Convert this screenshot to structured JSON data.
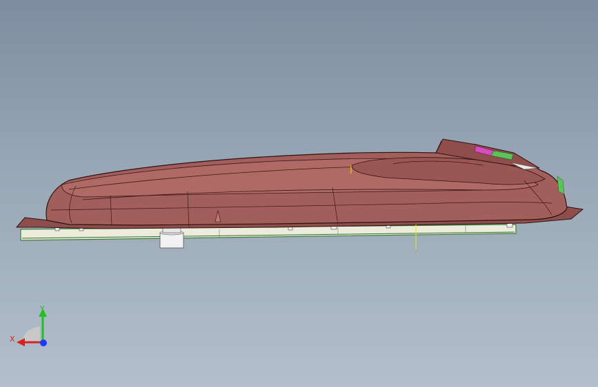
{
  "viewport": {
    "background_top": "#7e8d9f",
    "background_bottom": "#b3bfcb"
  },
  "model": {
    "shell_color": "#a25e5a",
    "edge_color": "#2b1110",
    "board_color": "#ececdc",
    "board_edge": "#3d7d3d",
    "accent_magenta": "#d84cc0",
    "accent_green": "#5bc45b",
    "marker_yellow": "#e8e800"
  },
  "triad": {
    "x_label": "X",
    "y_label": "Y",
    "x_color": "#e02020",
    "y_color": "#20c020",
    "z_color": "#1a3cff"
  }
}
